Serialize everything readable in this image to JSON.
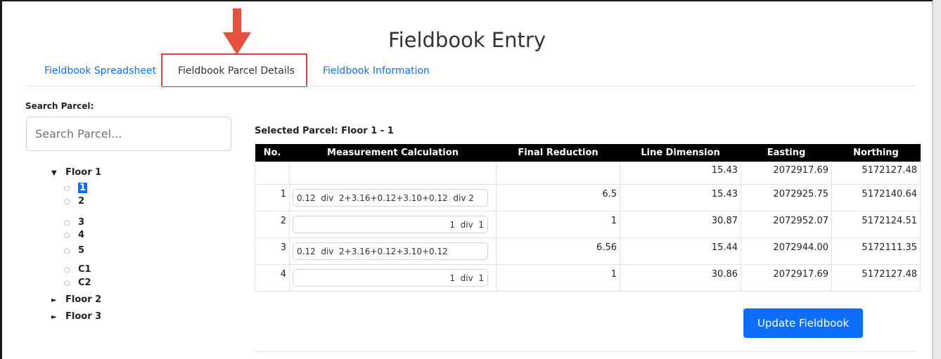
{
  "page": {
    "title": "Fieldbook Entry"
  },
  "tabs": [
    {
      "label": "Fieldbook Spreadsheet"
    },
    {
      "label": "Fieldbook Parcel Details",
      "active": true
    },
    {
      "label": "Fieldbook Information"
    }
  ],
  "colors": {
    "accent": "#0d6efd",
    "highlight": "#d9423a",
    "header_bg": "#000000"
  },
  "sidebar": {
    "search_label": "Search Parcel:",
    "search_placeholder": "Search Parcel...",
    "tree": [
      {
        "label": "Floor 1",
        "expanded": true,
        "items": [
          "1",
          "2",
          "3",
          "4",
          "5",
          "C1",
          "C2"
        ],
        "selected": "1"
      },
      {
        "label": "Floor 2",
        "expanded": false
      },
      {
        "label": "Floor 3",
        "expanded": false
      }
    ]
  },
  "main": {
    "selected_parcel": "Selected Parcel: Floor 1 - 1",
    "columns": [
      "No.",
      "Measurement Calculation",
      "Final Reduction",
      "Line Dimension",
      "Easting",
      "Northing"
    ],
    "rows": [
      {
        "no": "",
        "calc": "",
        "final": "",
        "line": "15.43",
        "easting": "2072917.69",
        "northing": "5172127.48"
      },
      {
        "no": "1",
        "calc": "0.12  div  2+3.16+0.12+3.10+0.12  div 2",
        "final": "6.5",
        "line": "15.43",
        "easting": "2072925.75",
        "northing": "5172140.64"
      },
      {
        "no": "2",
        "calc": "1  div  1",
        "final": "1",
        "line": "30.87",
        "easting": "2072952.07",
        "northing": "5172124.51"
      },
      {
        "no": "3",
        "calc": "0.12  div  2+3.16+0.12+3.10+0.12",
        "final": "6.56",
        "line": "15.44",
        "easting": "2072944.00",
        "northing": "5172111.35"
      },
      {
        "no": "4",
        "calc": "1  div  1",
        "final": "1",
        "line": "30.86",
        "easting": "2072917.69",
        "northing": "5172127.48"
      }
    ],
    "update_button": "Update Fieldbook"
  }
}
